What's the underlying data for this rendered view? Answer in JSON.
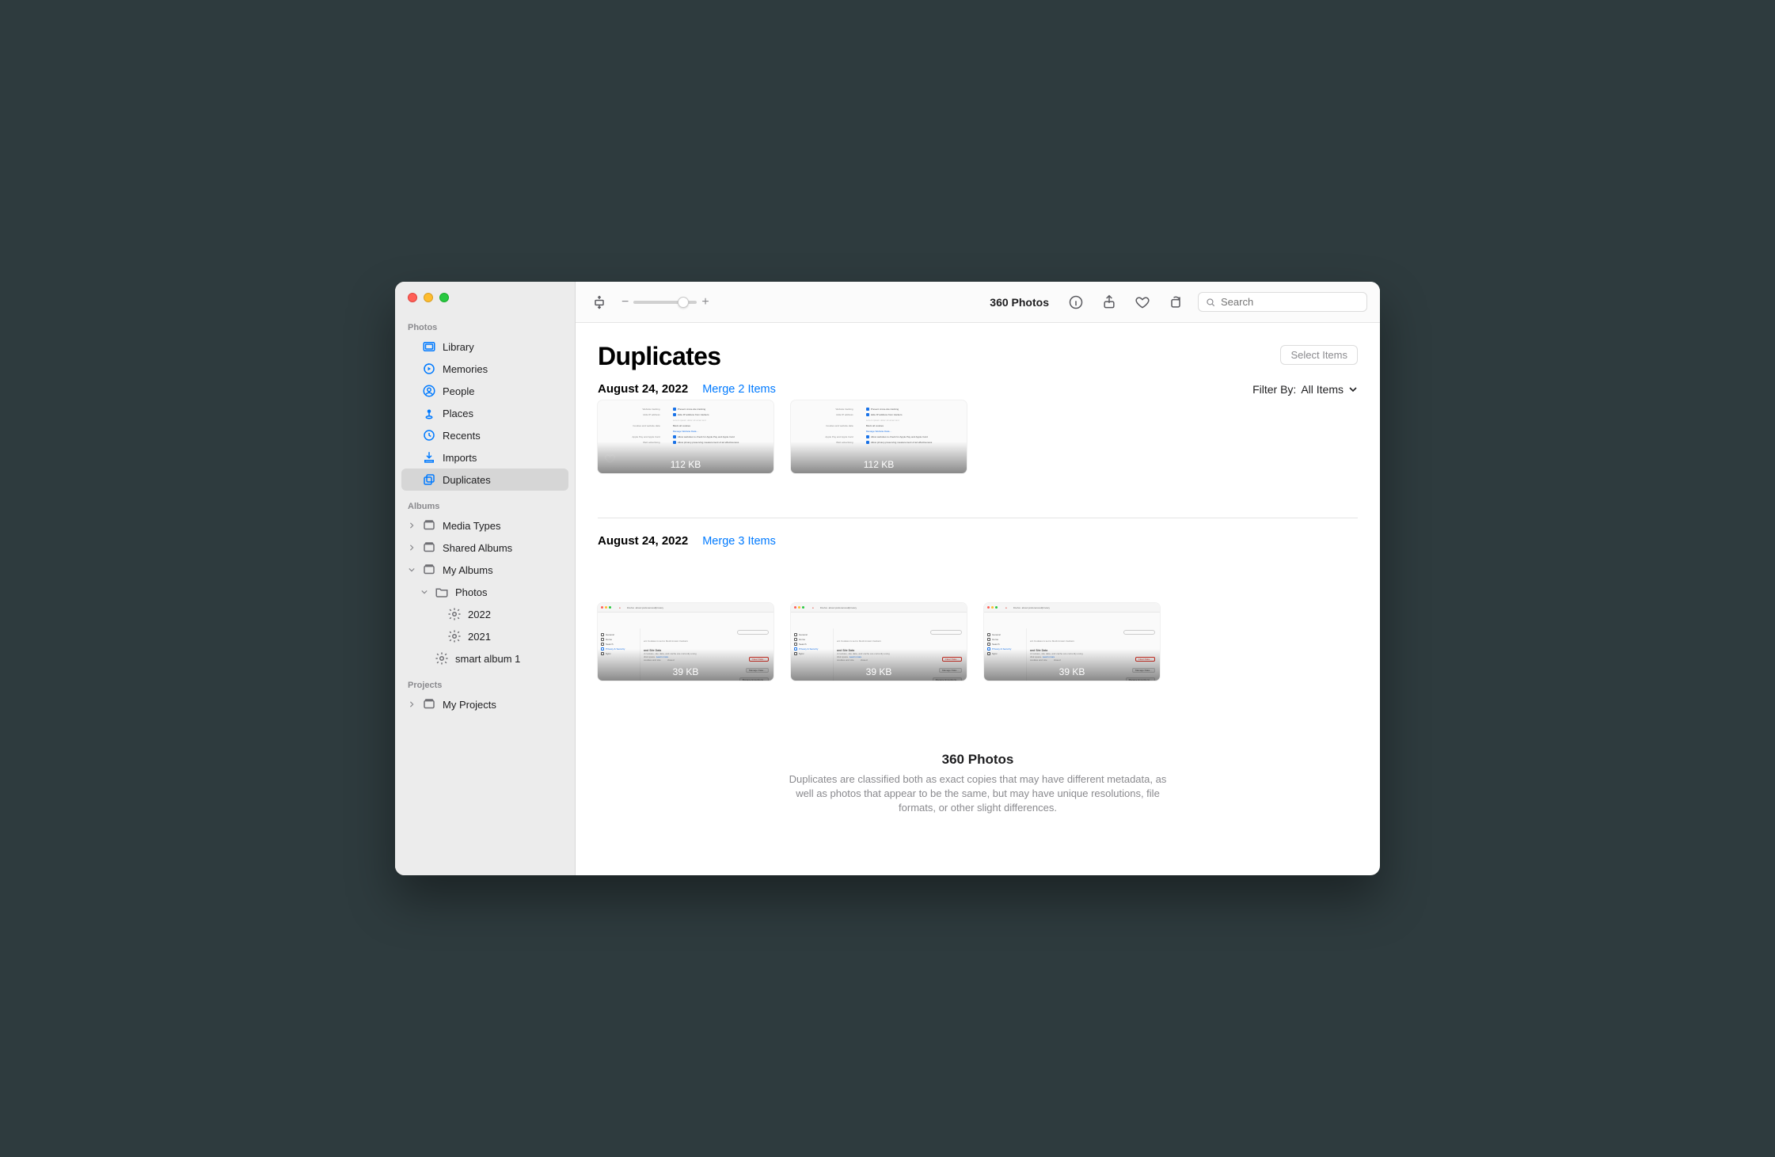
{
  "sidebar": {
    "section_photos": "Photos",
    "library": "Library",
    "memories": "Memories",
    "people": "People",
    "places": "Places",
    "recents": "Recents",
    "imports": "Imports",
    "duplicates": "Duplicates",
    "section_albums": "Albums",
    "media_types": "Media Types",
    "shared_albums": "Shared Albums",
    "my_albums": "My Albums",
    "album_photos": "Photos",
    "album_2022": "2022",
    "album_2021": "2021",
    "smart_album_1": "smart album 1",
    "section_projects": "Projects",
    "my_projects": "My Projects"
  },
  "toolbar": {
    "title": "360 Photos",
    "zoom_minus": "−",
    "zoom_plus": "+",
    "search_placeholder": "Search",
    "slider_percent": 78
  },
  "header": {
    "title": "Duplicates",
    "select_items": "Select Items",
    "filter_label": "Filter By:",
    "filter_value": "All Items"
  },
  "groups": [
    {
      "date": "August 24, 2022",
      "merge": "Merge 2 Items",
      "style": "partial",
      "items": [
        {
          "size": "112 KB",
          "favorite": true
        },
        {
          "size": "112 KB",
          "favorite": false
        }
      ]
    },
    {
      "date": "August 24, 2022",
      "merge": "Merge 3 Items",
      "style": "full",
      "items": [
        {
          "size": "39 KB",
          "favorite": false
        },
        {
          "size": "39 KB",
          "favorite": false
        },
        {
          "size": "39 KB",
          "favorite": false
        }
      ]
    }
  ],
  "footer": {
    "title": "360 Photos",
    "desc": "Duplicates are classified both as exact copies that may have different metadata, as well as photos that appear to be the same, but may have unique resolutions, file formats, or other slight differences."
  }
}
